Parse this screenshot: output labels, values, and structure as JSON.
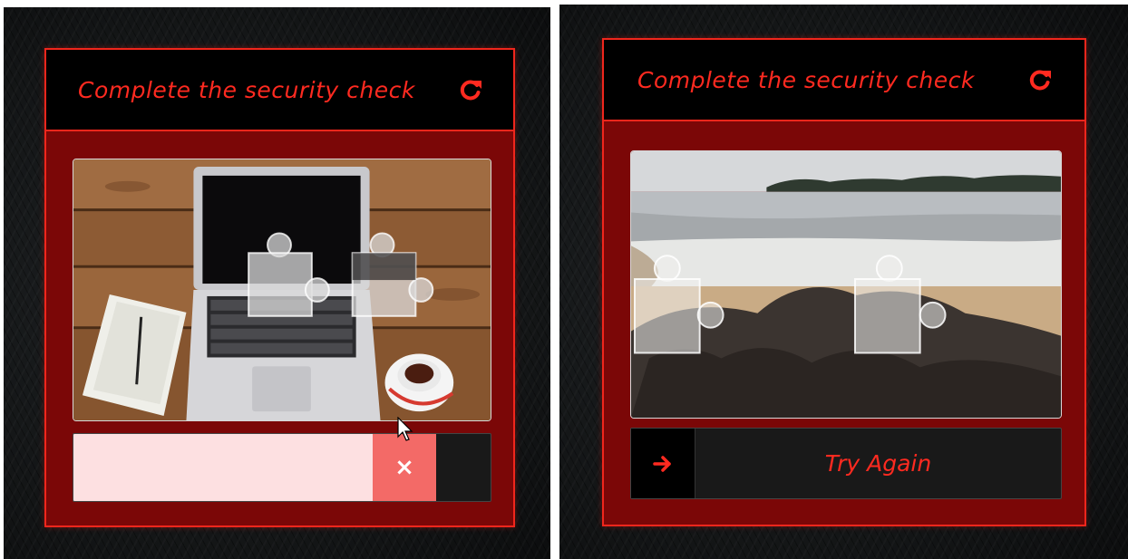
{
  "left_widget": {
    "title": "Complete the security check",
    "refresh_icon": "refresh-icon",
    "image": "laptop-on-wooden-desk",
    "slider_state": "failed",
    "slider_progress": 0.72,
    "handle_icon": "close-x-icon",
    "handle_glyph": "×"
  },
  "right_widget": {
    "title": "Complete the security check",
    "refresh_icon": "refresh-icon",
    "image": "rocky-beach-shoreline",
    "handle_icon": "arrow-right-icon",
    "message": "Try Again"
  },
  "colors": {
    "accent": "#f0261c",
    "panel": "#7b0707",
    "header": "#000000",
    "fail_handle": "#f36a67",
    "fail_track": "#fde0e1"
  }
}
